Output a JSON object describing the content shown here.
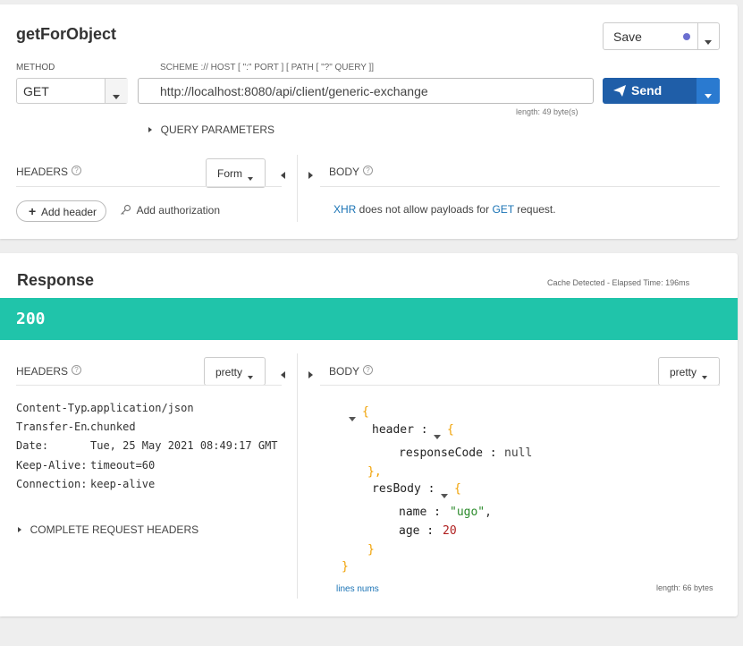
{
  "request": {
    "title": "getForObject",
    "save_label": "Save",
    "method_label": "METHOD",
    "method_value": "GET",
    "url_label": "SCHEME :// HOST [ \":\" PORT ] [ PATH [ \"?\" QUERY ]]",
    "url_value": "http://localhost:8080/api/client/generic-exchange",
    "length_note": "length: 49 byte(s)",
    "send_label": "Send",
    "query_params_label": "QUERY PARAMETERS",
    "headers_label": "HEADERS",
    "headers_mode": "Form",
    "add_header_label": "Add header",
    "add_auth_label": "Add authorization",
    "body_label": "BODY",
    "body_note": {
      "xhr": "XHR",
      "middle": " does not allow payloads for ",
      "get": "GET",
      "end": " request."
    }
  },
  "response": {
    "title": "Response",
    "meta": "Cache Detected - Elapsed Time: 196ms",
    "status_code": "200",
    "headers_label": "HEADERS",
    "headers_mode": "pretty",
    "body_label": "BODY",
    "body_mode": "pretty",
    "headers": [
      {
        "key": "Content-Typ…",
        "value": "application/json"
      },
      {
        "key": "Transfer-En…",
        "value": "chunked"
      },
      {
        "key": "Date:",
        "value": "Tue, 25 May 2021 08:49:17 GMT"
      },
      {
        "key": "Keep-Alive:",
        "value": "timeout=60"
      },
      {
        "key": "Connection:",
        "value": "keep-alive"
      }
    ],
    "complete_headers_label": "COMPLETE REQUEST HEADERS",
    "json": {
      "open_brace": "{",
      "header_key": "header",
      "responseCode_key": "responseCode",
      "responseCode_value": "null",
      "close_header": "},",
      "resBody_key": "resBody",
      "name_key": "name",
      "name_value": "\"ugo\"",
      "age_key": "age",
      "age_value": "20",
      "inner_close": "}",
      "outer_close": "}"
    },
    "lines_nums_label": "lines nums",
    "length_note": "length: 66 bytes"
  },
  "colors": {
    "status_bar": "#20c4aa",
    "send_button": "#1f5ea8",
    "save_dot": "#6b6fd0"
  }
}
